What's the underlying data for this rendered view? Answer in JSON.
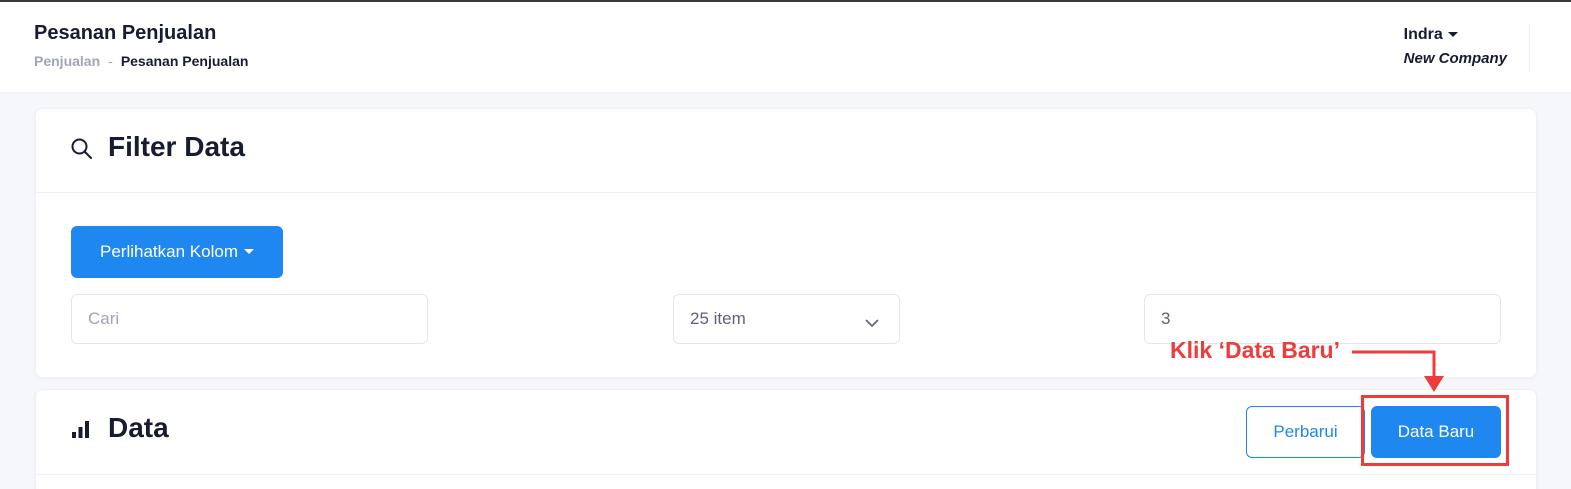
{
  "header": {
    "title": "Pesanan Penjualan",
    "breadcrumb": {
      "parent": "Penjualan",
      "separator": "-",
      "current": "Pesanan Penjualan"
    },
    "user": {
      "name": "Indra",
      "company": "New Company"
    }
  },
  "filter": {
    "title": "Filter Data",
    "icon": "search-icon",
    "columns_button": "Perlihatkan Kolom",
    "search_placeholder": "Cari",
    "page_size": "25 item",
    "page_number": "3"
  },
  "data_section": {
    "title": "Data",
    "icon": "bar-chart-icon",
    "refresh_button": "Perbarui",
    "new_button": "Data Baru"
  },
  "annotation": {
    "text": "Klik ‘Data Baru’",
    "color": "#ef3b3b"
  },
  "colors": {
    "primary": "#1e87f0",
    "title": "#181c32",
    "muted": "#a1a5b7"
  }
}
